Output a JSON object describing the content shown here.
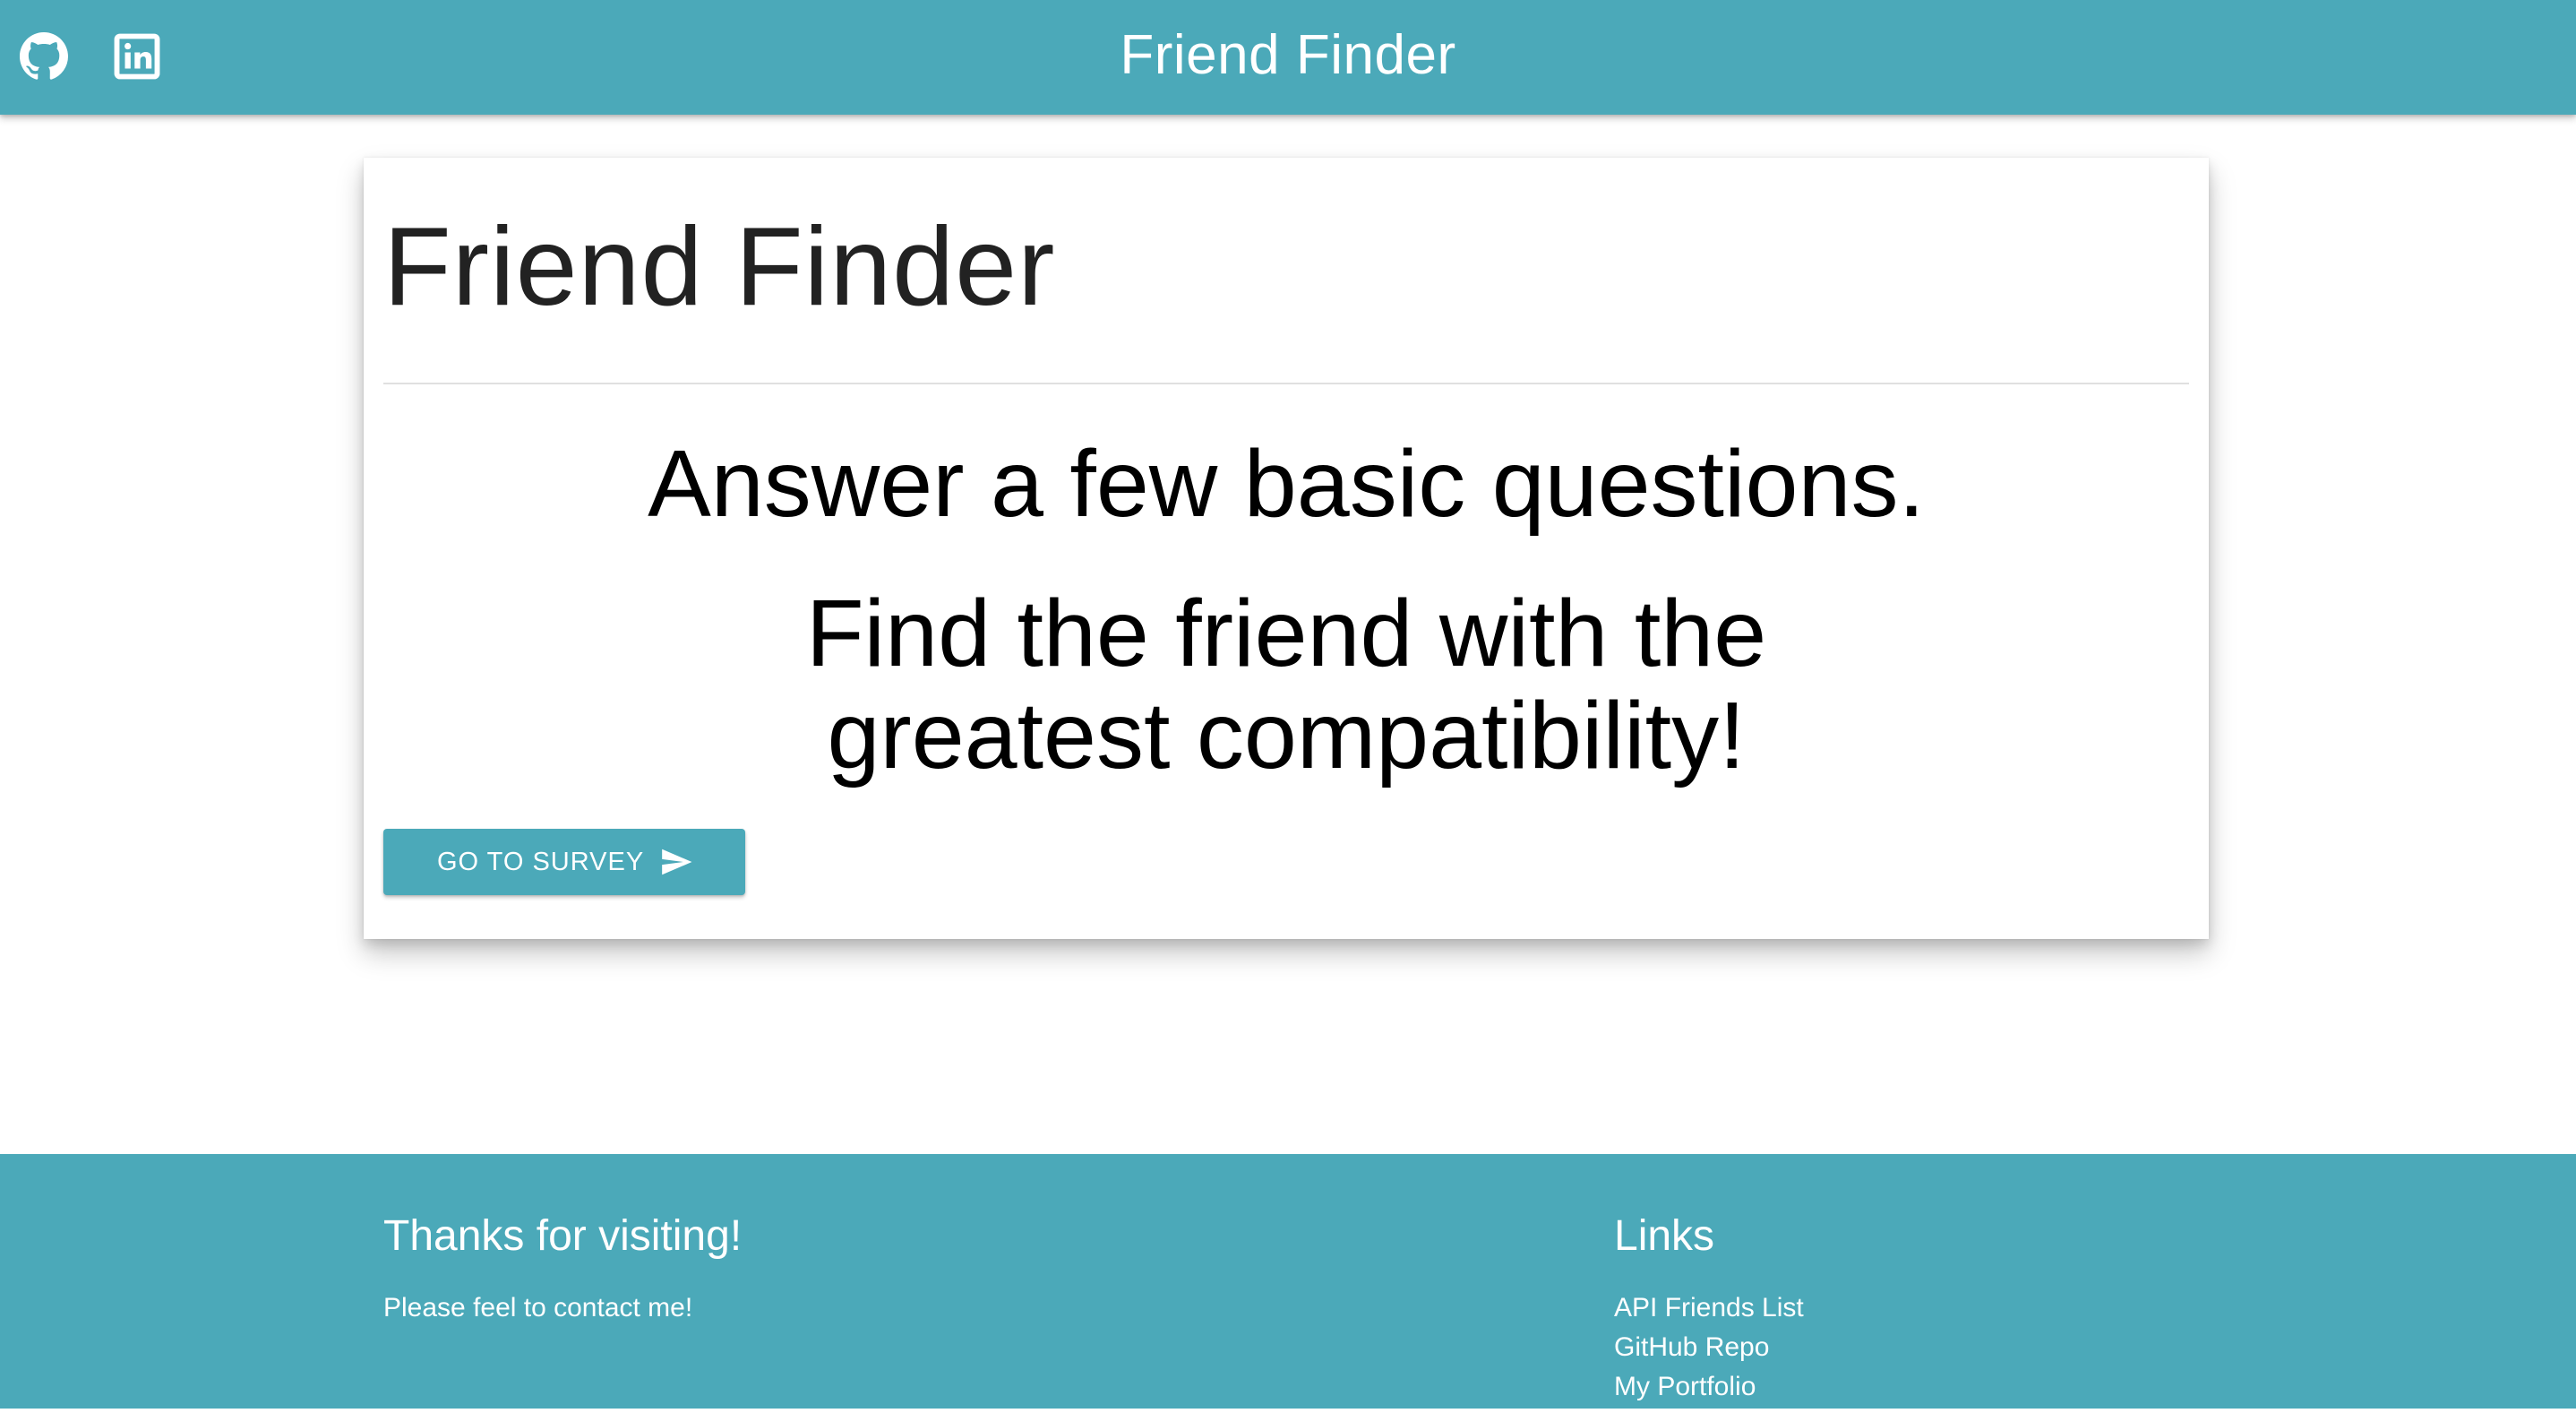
{
  "navbar": {
    "brand": "Friend Finder",
    "icons": {
      "github": "github-icon",
      "linkedin": "linkedin-icon"
    },
    "color": "#4ba9b9"
  },
  "card": {
    "title": "Friend Finder",
    "headline_1": "Answer a few basic questions.",
    "headline_2": "Find the friend with the greatest compatibility!",
    "button": {
      "label": "Go to Survey",
      "icon": "send-icon"
    }
  },
  "footer": {
    "left": {
      "heading": "Thanks for visiting!",
      "text": "Please feel to contact me!"
    },
    "right": {
      "heading": "Links",
      "links": [
        {
          "label": "API Friends List"
        },
        {
          "label": "GitHub Repo"
        },
        {
          "label": "My Portfolio"
        }
      ]
    },
    "color": "#4ba9b9"
  }
}
